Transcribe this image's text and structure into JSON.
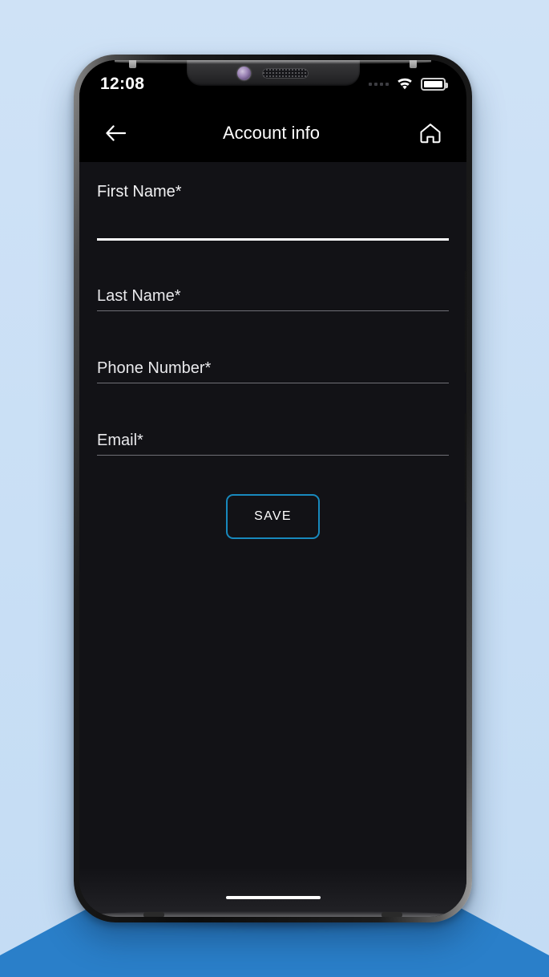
{
  "scene": {
    "background_color": "#cfe2f6",
    "pedestal_color": "#2a7fc9"
  },
  "phone": {
    "frame_color": "#0c0c0c",
    "side_buttons": [
      {
        "name": "volume-button"
      },
      {
        "name": "power-button"
      }
    ],
    "notch": {
      "camera": "front-camera-icon",
      "speaker": "earpiece-speaker-icon"
    }
  },
  "status_bar": {
    "time": "12:08",
    "signal_icon": "signal-dots-icon",
    "wifi_icon": "wifi-icon",
    "battery_icon": "battery-icon",
    "battery_level": "full"
  },
  "app_bar": {
    "back_icon": "back-arrow-icon",
    "title": "Account info",
    "home_icon": "home-icon",
    "background_color": "#000000"
  },
  "form": {
    "accent_color": "#1889bd",
    "fields": [
      {
        "name": "first-name",
        "label": "First Name*",
        "value": "",
        "placeholder": "First Name*",
        "state": "focused",
        "underline_color": "#ffffff"
      },
      {
        "name": "last-name",
        "label": "Last Name*",
        "value": "",
        "placeholder": "Last Name*",
        "state": "idle",
        "underline_color": "#6f6f76"
      },
      {
        "name": "phone-number",
        "label": "Phone Number*",
        "value": "",
        "placeholder": "Phone Number*",
        "state": "idle",
        "underline_color": "#6f6f76"
      },
      {
        "name": "email",
        "label": "Email*",
        "value": "",
        "placeholder": "Email*",
        "state": "idle",
        "underline_color": "#6f6f76"
      }
    ],
    "save_label": "SAVE"
  },
  "system_nav": {
    "home_indicator": "home-indicator"
  }
}
